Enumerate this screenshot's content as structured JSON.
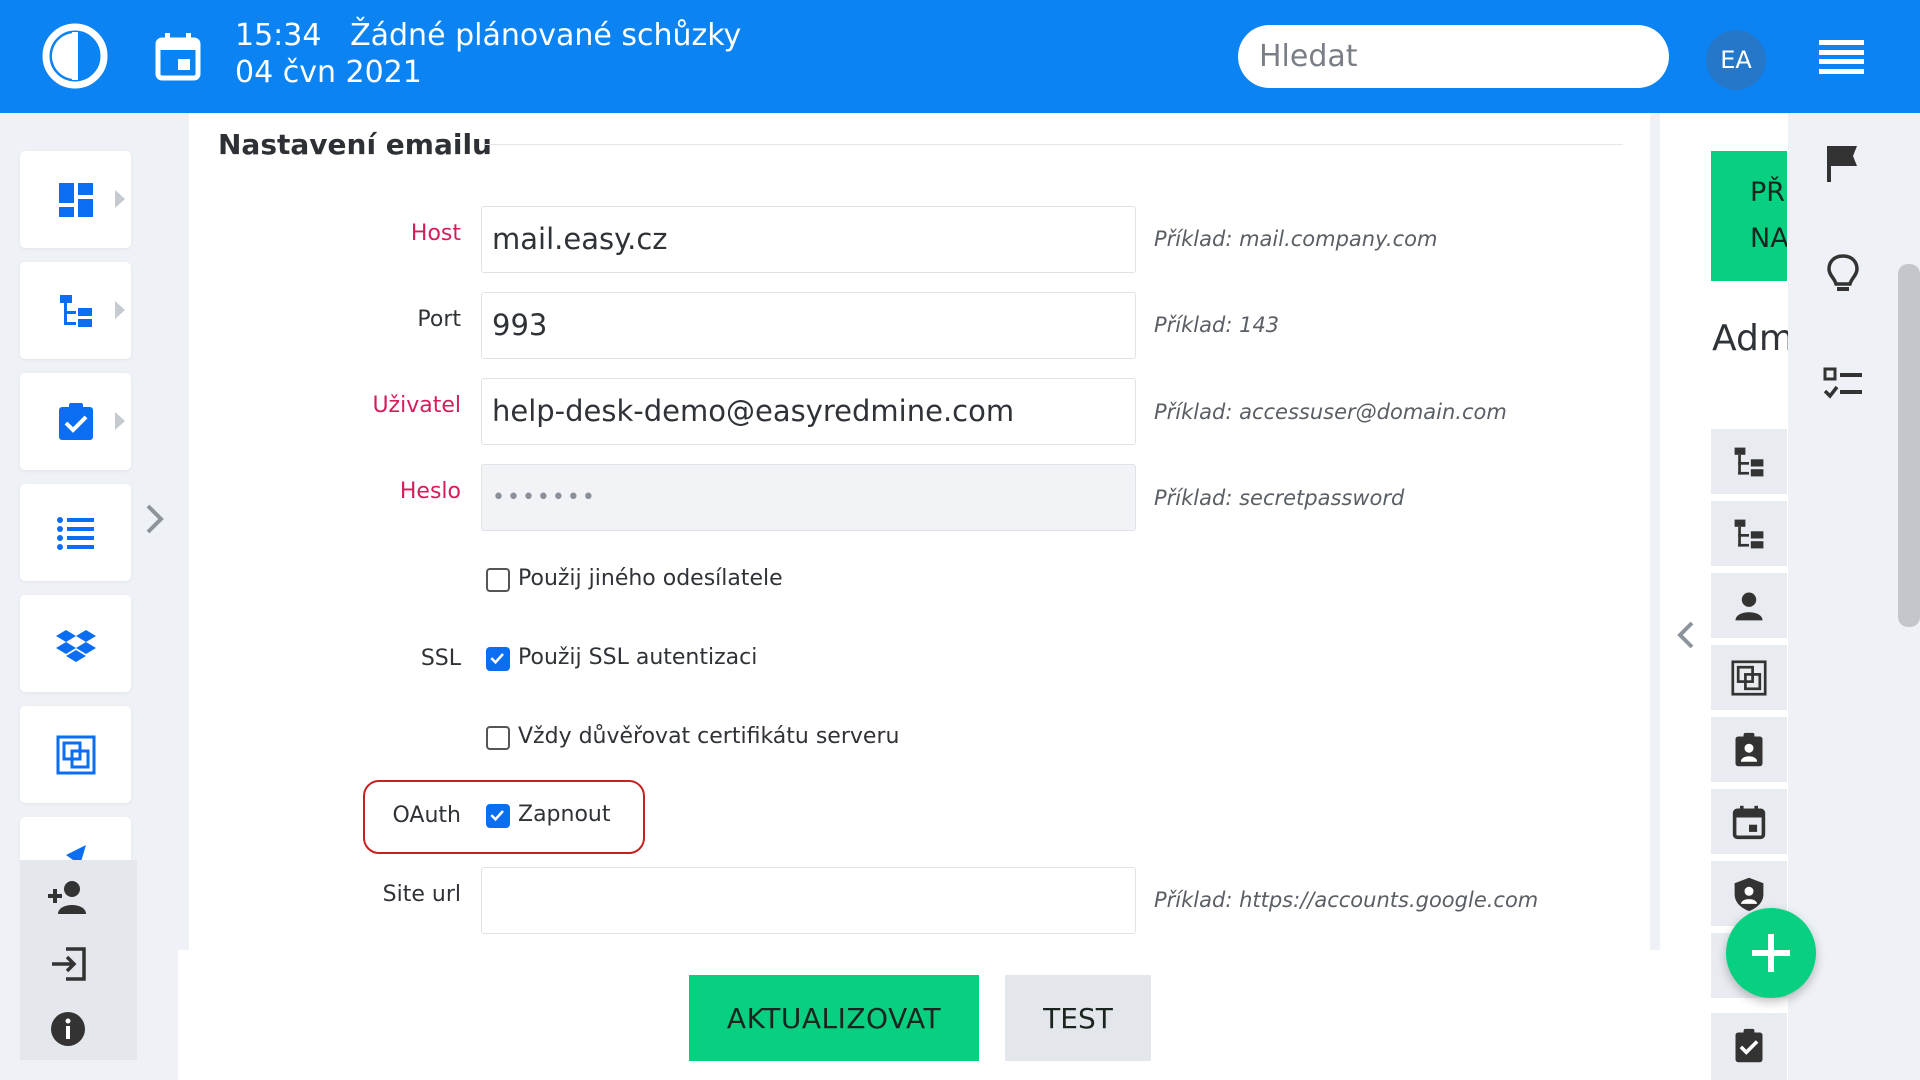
{
  "header": {
    "time": "15:34",
    "meeting_status": "Žádné plánované schůzky",
    "date": "04 čvn 2021",
    "search_placeholder": "Hledat",
    "avatar_initials": "EA"
  },
  "form": {
    "section_title": "Nastavení emailu",
    "fields": [
      {
        "label": "Host",
        "value": "mail.easy.cz",
        "hint": "Příklad: mail.company.com",
        "required": true
      },
      {
        "label": "Port",
        "value": "993",
        "hint": "Příklad: 143",
        "required": false
      },
      {
        "label": "Uživatel",
        "value": "help-desk-demo@easyredmine.com",
        "hint": "Příklad: accessuser@domain.com",
        "required": true
      },
      {
        "label": "Heslo",
        "value": "•••••••",
        "hint": "Příklad: secretpassword",
        "required": true
      }
    ],
    "checkboxes": [
      {
        "label": "",
        "text": "Použij jiného odesílatele",
        "checked": false
      },
      {
        "label": "SSL",
        "text": "Použij SSL autentizaci",
        "checked": true
      },
      {
        "label": "",
        "text": "Vždy důvěřovat certifikátu serveru",
        "checked": false
      },
      {
        "label": "OAuth",
        "text": "Zapnout",
        "checked": true
      }
    ],
    "site_url": {
      "label": "Site url",
      "value": "",
      "hint": "Příklad: https://accounts.google.com"
    }
  },
  "buttons": {
    "update": "AKTUALIZOVAT",
    "test": "TEST"
  },
  "right_panel": {
    "card_line1": "PŘ",
    "card_line2": "NA",
    "title_fragment": "Adm"
  },
  "colors": {
    "header_bg": "#0b83f2",
    "accent_green": "#08d081",
    "required_label": "#d81b5c",
    "checkbox_checked": "#0b6ef2",
    "highlight_ring": "#c82020"
  },
  "icons": {
    "header": [
      "logo-icon",
      "calendar-icon",
      "hamburger-menu-icon"
    ],
    "left_sidebar": [
      "dashboard-icon",
      "hierarchy-icon",
      "task-check-icon",
      "list-icon",
      "dropbox-icon",
      "frame-icon",
      "add-user-icon",
      "login-icon",
      "info-icon"
    ],
    "right_sidebar": [
      "flag-icon",
      "lightbulb-icon",
      "checklist-icon",
      "chevron-left-icon",
      "plus-icon"
    ]
  }
}
